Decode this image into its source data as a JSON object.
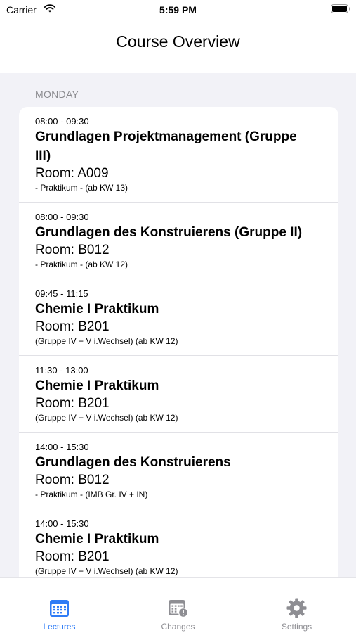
{
  "status_bar": {
    "carrier": "Carrier",
    "time": "5:59 PM"
  },
  "nav": {
    "title": "Course Overview"
  },
  "section": {
    "header": "MONDAY"
  },
  "lectures": [
    {
      "time": "08:00 - 09:30",
      "title": "Grundlagen Projektmanagement (Gruppe III)",
      "room": "Room: A009",
      "note": "- Praktikum -  (ab KW 13)"
    },
    {
      "time": "08:00 - 09:30",
      "title": "Grundlagen des Konstruierens (Gruppe II)",
      "room": "Room: B012",
      "note": "- Praktikum - (ab KW 12)"
    },
    {
      "time": "09:45 - 11:15",
      "title": "Chemie I  Praktikum",
      "room": "Room: B201",
      "note": "(Gruppe IV + V i.Wechsel)  (ab KW 12)"
    },
    {
      "time": "11:30 - 13:00",
      "title": "Chemie I  Praktikum",
      "room": "Room: B201",
      "note": "(Gruppe IV + V i.Wechsel)  (ab KW 12)"
    },
    {
      "time": "14:00 - 15:30",
      "title": "Grundlagen des Konstruierens",
      "room": "Room: B012",
      "note": "- Praktikum - (IMB Gr. IV + IN)"
    },
    {
      "time": "14:00 - 15:30",
      "title": "Chemie I  Praktikum",
      "room": "Room: B201",
      "note": "(Gruppe IV + V i.Wechsel)  (ab KW 12)"
    }
  ],
  "tabs": [
    {
      "label": "Lectures",
      "icon": "calendar-icon",
      "active": true
    },
    {
      "label": "Changes",
      "icon": "calendar-alert-icon",
      "active": false
    },
    {
      "label": "Settings",
      "icon": "gear-icon",
      "active": false
    }
  ],
  "colors": {
    "accent": "#2f7cf6",
    "inactive": "#8e8e93",
    "background": "#f2f2f7",
    "section_header": "#8a8a8e"
  }
}
